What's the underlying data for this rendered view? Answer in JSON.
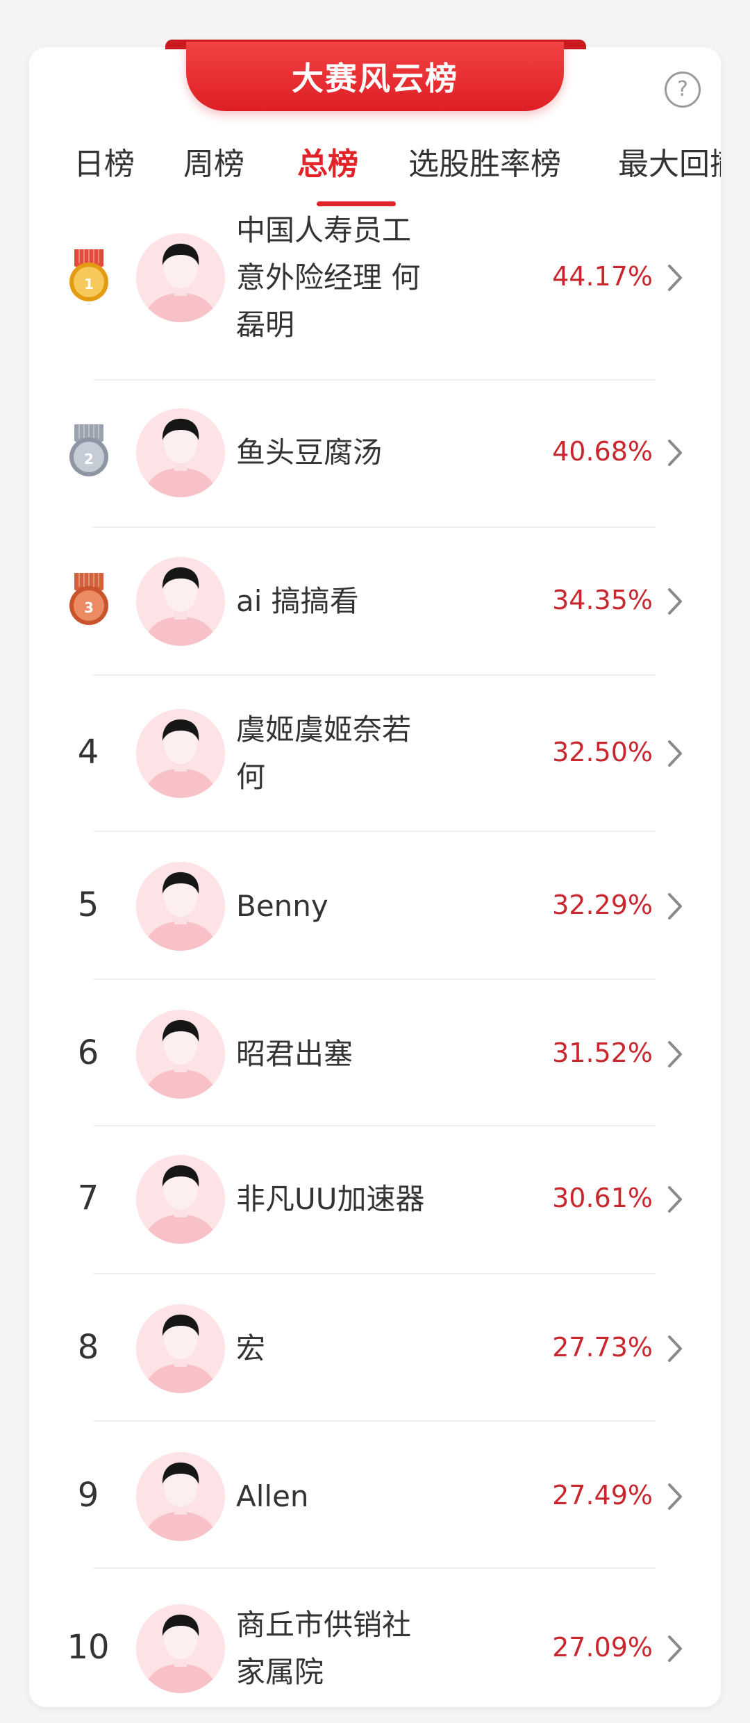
{
  "header": {
    "title": "大赛风云榜",
    "help_symbol": "?"
  },
  "tabs": [
    {
      "label": "日榜"
    },
    {
      "label": "周榜"
    },
    {
      "label": "总榜"
    },
    {
      "label": "选股胜率榜"
    },
    {
      "label": "最大回撤"
    }
  ],
  "active_tab": "总榜",
  "colors": {
    "accent": "#e0242a",
    "percent": "#c8272d",
    "gold": "#f2b632",
    "silver": "#a9b0bd",
    "bronze": "#d9704a"
  },
  "leaderboard": [
    {
      "rank": "1",
      "medal": "gold",
      "name": "中国人寿员工意外险经理 何磊明",
      "percent": "44.17%"
    },
    {
      "rank": "2",
      "medal": "silver",
      "name": "鱼头豆腐汤",
      "percent": "40.68%"
    },
    {
      "rank": "3",
      "medal": "bronze",
      "name": "ai 搞搞看",
      "percent": "34.35%"
    },
    {
      "rank": "4",
      "name": "虞姬虞姬奈若何",
      "percent": "32.50%"
    },
    {
      "rank": "5",
      "name": "Benny",
      "percent": "32.29%"
    },
    {
      "rank": "6",
      "name": "昭君出塞",
      "percent": "31.52%"
    },
    {
      "rank": "7",
      "name": "非凡UU加速器",
      "percent": "30.61%"
    },
    {
      "rank": "8",
      "name": "宏",
      "percent": "27.73%"
    },
    {
      "rank": "9",
      "name": "Allen",
      "percent": "27.49%"
    },
    {
      "rank": "10",
      "name": "商丘市供销社家属院",
      "percent": "27.09%"
    }
  ]
}
